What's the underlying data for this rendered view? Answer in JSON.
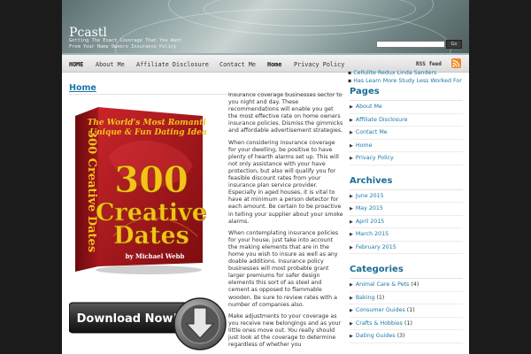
{
  "site": {
    "title": "Pcastl",
    "description": "Getting The Exact Coverage That You Want From Your Home Owners Insurance Policy"
  },
  "search": {
    "button_label": "Go",
    "value": ""
  },
  "nav": {
    "items": [
      {
        "label": "HOME",
        "active": true
      },
      {
        "label": "About Me",
        "active": false
      },
      {
        "label": "Affiliate Disclosure",
        "active": false
      },
      {
        "label": "Contact Me",
        "active": false
      },
      {
        "label": "Home",
        "active": true
      },
      {
        "label": "Privacy Policy",
        "active": false
      }
    ],
    "rss_label": "RSS feed",
    "rss_icon": "rss-icon"
  },
  "ticker": [
    "Cellulite Redux Linda Sanders",
    "Has Learn More Study Less Worked For"
  ],
  "main": {
    "heading": "Home",
    "book": {
      "top_line_1": "The World's Most Romantic,",
      "top_line_2": "Unique & Fun Dating Ideas",
      "big_number": "300",
      "big_word_1": "Creative",
      "big_word_2": "Dates",
      "author": "by Michael Webb",
      "spine": "300 Creative Dates"
    },
    "download_label": "Download Now!",
    "paragraphs": [
      "Insurance coverage businesses sector to you night and day. These recommendations will enable you get the most effective rate on home owners insurance policies. Dismiss the gimmicks and affordable advertisement strategies.",
      "When considering insurance coverage for your dwelling, be positive to have plenty of hearth alarms set up. This will not only assistance with your have protection, but also will qualify you for feasible discount rates from your insurance plan service provider. Especially in aged houses, it is vital to have at minimum a person detector for each amount. Be certain to be proactive in telling your supplier about your smoke alarms.",
      "When contemplating insurance policies for your house, just take into account the making elements that are in the home you wish to insure as well as any doable additions. Insurance policy businesses will most probable grant larger premiums for safer design elements this sort of as steel and cement as opposed to flammable wooden. Be sure to review rates with a number of companies also.",
      "Make adjustments to your coverage as you receive new belongings and as your little ones move out. You really should just look at the coverage to determine regardless of whether you"
    ]
  },
  "sidebar": {
    "pages": {
      "title": "Pages",
      "items": [
        "About Me",
        "Affiliate Disclosure",
        "Contact Me",
        "Home",
        "Privacy Policy"
      ]
    },
    "archives": {
      "title": "Archives",
      "items": [
        "June 2015",
        "May 2015",
        "April 2015",
        "March 2015",
        "February 2015"
      ]
    },
    "categories": {
      "title": "Categories",
      "items": [
        {
          "label": "Animal Care & Pets",
          "count": "(4)"
        },
        {
          "label": "Baking",
          "count": "(1)"
        },
        {
          "label": "Consumer Guides",
          "count": "(1)"
        },
        {
          "label": "Crafts & Hobbies",
          "count": "(1)"
        },
        {
          "label": "Dating Guides",
          "count": "(3)"
        }
      ]
    }
  },
  "colors": {
    "link": "#1b78a8",
    "widget_title": "#1b6d96",
    "page_bg": "#1b1b1b",
    "book_red": "#b0181e",
    "book_gold": "#f3c318"
  }
}
